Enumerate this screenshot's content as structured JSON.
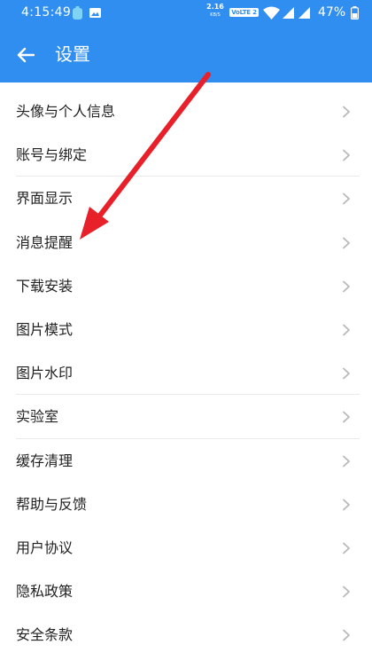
{
  "status_bar": {
    "time": "4:15:49",
    "net_speed_value": "2.16",
    "net_speed_unit": "KB/S",
    "volte_label": "VoLTE 2",
    "battery_percent": "47%",
    "icons": [
      "notification-icon",
      "image-icon",
      "wifi-icon",
      "signal-icon",
      "battery-icon"
    ]
  },
  "app_bar": {
    "title": "设置",
    "back_icon": "arrow-left-icon"
  },
  "settings": {
    "items": [
      {
        "label": "头像与个人信息",
        "divider_after": false
      },
      {
        "label": "账号与绑定",
        "divider_after": true
      },
      {
        "label": "界面显示",
        "divider_after": false
      },
      {
        "label": "消息提醒",
        "divider_after": false
      },
      {
        "label": "下载安装",
        "divider_after": false
      },
      {
        "label": "图片模式",
        "divider_after": false
      },
      {
        "label": "图片水印",
        "divider_after": true
      },
      {
        "label": "实验室",
        "divider_after": true
      },
      {
        "label": "缓存清理",
        "divider_after": false
      },
      {
        "label": "帮助与反馈",
        "divider_after": false
      },
      {
        "label": "用户协议",
        "divider_after": false
      },
      {
        "label": "隐私政策",
        "divider_after": false
      },
      {
        "label": "安全条款",
        "divider_after": false
      }
    ],
    "chevron_icon": "chevron-right-icon"
  },
  "annotation": {
    "icon": "red-arrow-annotation",
    "color": "#e8202a"
  },
  "colors": {
    "accent": "#2f8ef0",
    "text": "#222222",
    "chevron": "#b8b8b8",
    "divider": "#e9e9e9"
  }
}
